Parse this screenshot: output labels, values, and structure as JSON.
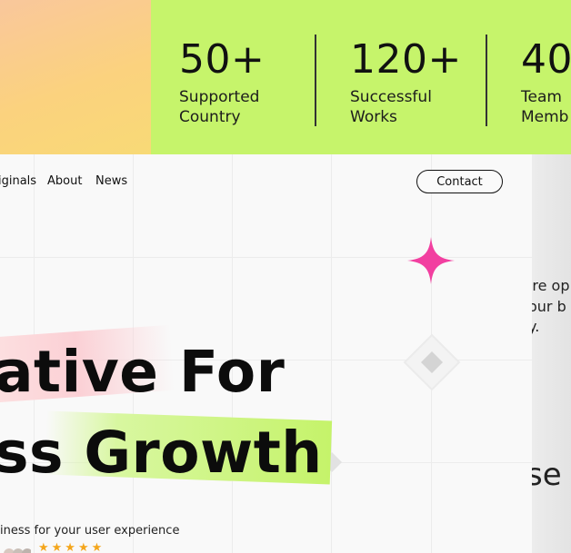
{
  "stats": [
    {
      "number": "50+",
      "label_line1": "Supported",
      "label_line2": "Country"
    },
    {
      "number": "120+",
      "label_line1": "Successful",
      "label_line2": "Works"
    },
    {
      "number": "40",
      "label_line1": "Team",
      "label_line2": "Memb"
    }
  ],
  "nav": {
    "items": [
      "iginals",
      "About",
      "News"
    ],
    "contact_label": "Contact"
  },
  "hero": {
    "line1": "ative For",
    "line2": "ss Growth",
    "tagline": "iness for your user experience",
    "stars": "★★★★★"
  },
  "side_panel": {
    "line1": "'re op",
    "line2": "our b",
    "line3": "y.",
    "fragment": "se"
  },
  "colors": {
    "stats_bg": "#c6f46b",
    "sparkle": "#f23fa0",
    "star": "#f4a61c"
  }
}
